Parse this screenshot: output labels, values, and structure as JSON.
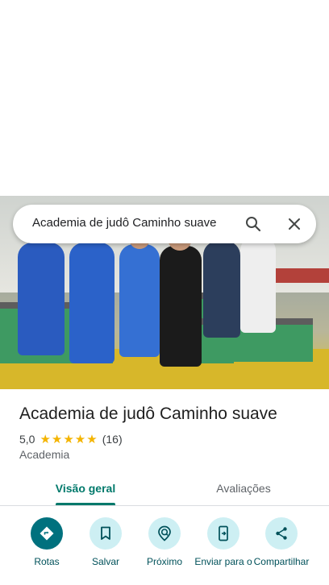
{
  "search": {
    "query": "Academia de judô Caminho suave"
  },
  "place": {
    "name": "Academia de judô Caminho suave",
    "rating": "5,0",
    "stars": "★★★★★",
    "review_count": "(16)",
    "category": "Academia"
  },
  "tabs": [
    {
      "label": "Visão geral",
      "selected": true
    },
    {
      "label": "Avaliações",
      "selected": false
    }
  ],
  "actions": [
    {
      "label": "Rotas",
      "icon": "directions-icon"
    },
    {
      "label": "Salvar",
      "icon": "bookmark-icon"
    },
    {
      "label": "Próximo",
      "icon": "nearby-icon"
    },
    {
      "label": "Enviar para o",
      "icon": "send-to-phone-icon"
    },
    {
      "label": "Compartilhar",
      "icon": "share-icon"
    }
  ],
  "colors": {
    "accent": "#00796b",
    "action_bg": "#cdeff3",
    "primary_action": "#00717e",
    "star": "#f4b400"
  }
}
